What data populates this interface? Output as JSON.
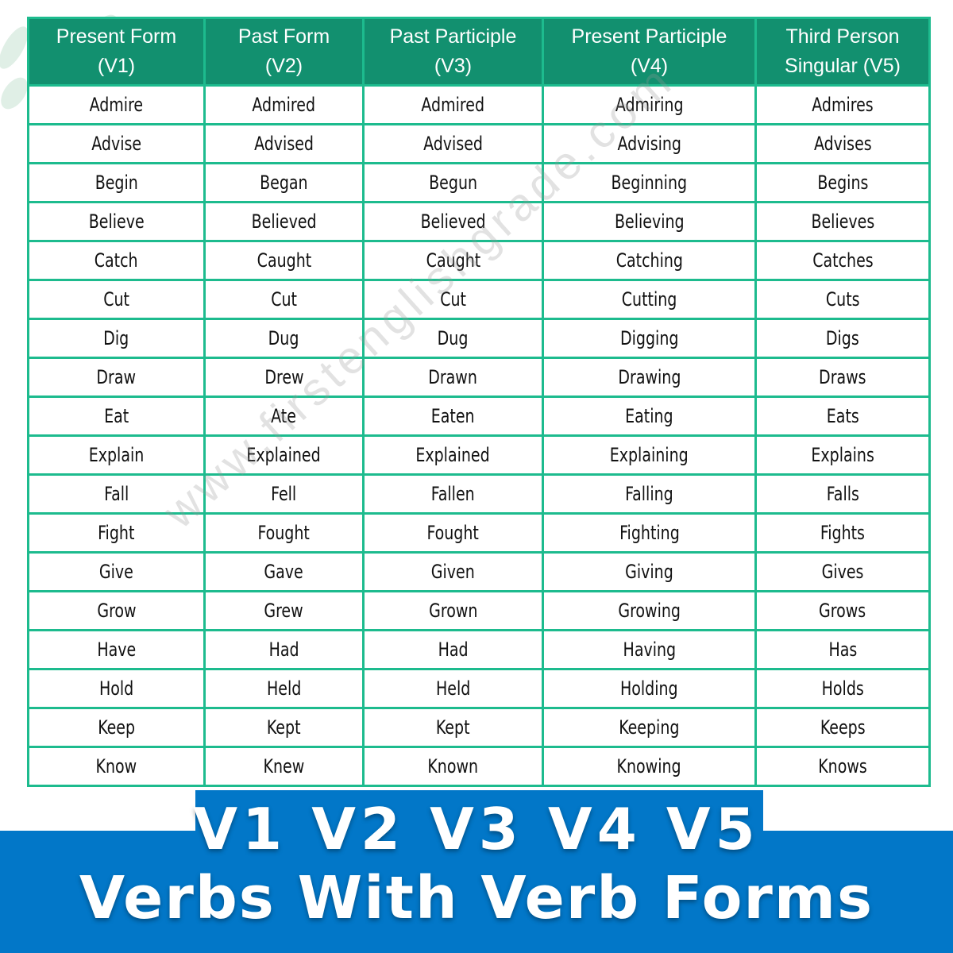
{
  "title_line1": "V1 V2 V3 V4 V5",
  "title_line2": "Verbs With Verb Forms",
  "watermark": "www.firstenglishgrade.com",
  "colors": {
    "header_bg": "#12906f",
    "border": "#1dbb8e",
    "banner": "#0277c8"
  },
  "headers": [
    "Present Form\n(V1)",
    "Past Form\n(V2)",
    "Past Participle\n(V3)",
    "Present Participle\n(V4)",
    "Third Person\nSingular (V5)"
  ],
  "rows": [
    [
      "Admire",
      "Admired",
      "Admired",
      "Admiring",
      "Admires"
    ],
    [
      "Advise",
      "Advised",
      "Advised",
      "Advising",
      "Advises"
    ],
    [
      "Begin",
      "Began",
      "Begun",
      "Beginning",
      "Begins"
    ],
    [
      "Believe",
      "Believed",
      "Believed",
      "Believing",
      "Believes"
    ],
    [
      "Catch",
      "Caught",
      "Caught",
      "Catching",
      "Catches"
    ],
    [
      "Cut",
      "Cut",
      "Cut",
      "Cutting",
      "Cuts"
    ],
    [
      "Dig",
      "Dug",
      "Dug",
      "Digging",
      "Digs"
    ],
    [
      "Draw",
      "Drew",
      "Drawn",
      "Drawing",
      "Draws"
    ],
    [
      "Eat",
      "Ate",
      "Eaten",
      "Eating",
      "Eats"
    ],
    [
      "Explain",
      "Explained",
      "Explained",
      "Explaining",
      "Explains"
    ],
    [
      "Fall",
      "Fell",
      "Fallen",
      "Falling",
      "Falls"
    ],
    [
      "Fight",
      "Fought",
      "Fought",
      "Fighting",
      "Fights"
    ],
    [
      "Give",
      "Gave",
      "Given",
      "Giving",
      "Gives"
    ],
    [
      "Grow",
      "Grew",
      "Grown",
      "Growing",
      "Grows"
    ],
    [
      "Have",
      "Had",
      "Had",
      "Having",
      "Has"
    ],
    [
      "Hold",
      "Held",
      "Held",
      "Holding",
      "Holds"
    ],
    [
      "Keep",
      "Kept",
      "Kept",
      "Keeping",
      "Keeps"
    ],
    [
      "Know",
      "Knew",
      "Known",
      "Knowing",
      "Knows"
    ]
  ]
}
